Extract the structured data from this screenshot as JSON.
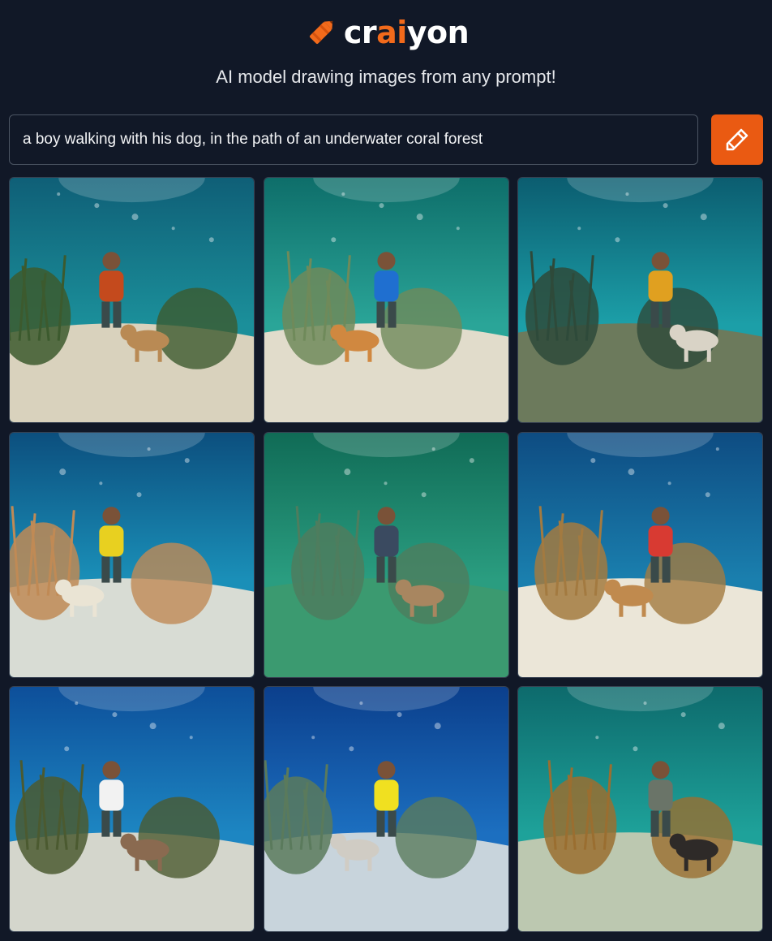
{
  "brand": {
    "logo_parts": [
      "cr",
      "ai",
      "yon"
    ],
    "logo_icon": "crayon-icon",
    "accent_color": "#f26a1b"
  },
  "tagline": "AI model drawing images from any prompt!",
  "prompt": {
    "value": "a boy walking with his dog, in the path of an underwater coral forest",
    "submit_icon": "pencil-icon",
    "submit_color": "#ea5a12"
  },
  "results": {
    "count": 9,
    "images": [
      {
        "water": "#1b8f9a",
        "deep": "#0f5f77",
        "sand": "#d9d2bd",
        "shirt": "#c44a1d",
        "dog": "#b98a54",
        "coral": "#3c5a2e"
      },
      {
        "water": "#2aa598",
        "deep": "#0e6e6a",
        "sand": "#e1dccb",
        "shirt": "#1f6fd0",
        "dog": "#d08840",
        "coral": "#6f8a5a"
      },
      {
        "water": "#1c9fa8",
        "deep": "#0b5d70",
        "sand": "#6c7a5c",
        "shirt": "#e0a020",
        "dog": "#d9d3c6",
        "coral": "#2e4a3a"
      },
      {
        "water": "#1a8fb8",
        "deep": "#0c4f7e",
        "sand": "#d8dcd4",
        "shirt": "#e8d020",
        "dog": "#eae4d4",
        "coral": "#c08a55"
      },
      {
        "water": "#2a9d80",
        "deep": "#106b56",
        "sand": "#3b9a70",
        "shirt": "#3a4a60",
        "dog": "#a88660",
        "coral": "#4e7d5e"
      },
      {
        "water": "#1a7fae",
        "deep": "#0e4c82",
        "sand": "#ebe6d8",
        "shirt": "#d83a32",
        "dog": "#c08a4e",
        "coral": "#a37a40"
      },
      {
        "water": "#1d86c2",
        "deep": "#0d4f9a",
        "sand": "#d4d6cc",
        "shirt": "#f2f2f2",
        "dog": "#8a6a50",
        "coral": "#4b5a30"
      },
      {
        "water": "#1c6fc0",
        "deep": "#0b3f8c",
        "sand": "#c8d4dc",
        "shirt": "#f0e020",
        "dog": "#d0ccc4",
        "coral": "#5a7a5c"
      },
      {
        "water": "#1ea29a",
        "deep": "#0d6a6c",
        "sand": "#bcc8b0",
        "shirt": "#6a7468",
        "dog": "#2e2a28",
        "coral": "#9a6e30"
      }
    ]
  }
}
